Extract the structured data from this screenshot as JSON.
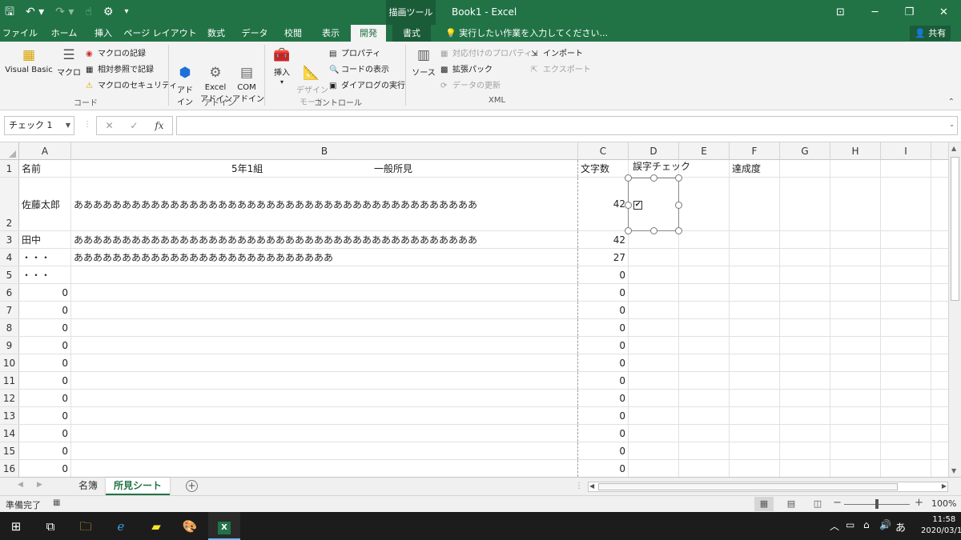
{
  "window": {
    "context_tab_title": "描画ツール",
    "doc_title": "Book1  -  Excel"
  },
  "tabs": [
    "ファイル",
    "ホーム",
    "挿入",
    "ページ レイアウト",
    "数式",
    "データ",
    "校閲",
    "表示",
    "開発",
    "書式"
  ],
  "active_tab": "開発",
  "tell_me": "実行したい作業を入力してください...",
  "share": "共有",
  "ribbon": {
    "code": {
      "visual_basic": "Visual Basic",
      "macro": "マクロ",
      "record_macro": "マクロの記録",
      "relative_ref": "相対参照で記録",
      "macro_security": "マクロのセキュリティ",
      "label": "コード"
    },
    "addins": {
      "addin": "アド\nイン",
      "excel_addin": "Excel\nアドイン",
      "com_addin": "COM\nアドイン",
      "label": "アドイン"
    },
    "controls": {
      "insert": "挿入",
      "design_mode": "デザイン\nモード",
      "properties": "プロパティ",
      "view_code": "コードの表示",
      "run_dialog": "ダイアログの実行",
      "label": "コントロール"
    },
    "xml": {
      "source": "ソース",
      "map_properties": "対応付けのプロパティ",
      "expansion_packs": "拡張パック",
      "refresh_data": "データの更新",
      "import": "インポート",
      "export": "エクスポート",
      "label": "XML"
    }
  },
  "formula_bar": {
    "name_box": "チェック 1",
    "fx": "fx",
    "value": ""
  },
  "columns": [
    "A",
    "B",
    "C",
    "D",
    "E",
    "F",
    "G",
    "H",
    "I"
  ],
  "rows": [
    {
      "n": "1",
      "a": "名前",
      "b_left": "5年1組",
      "b_right": "一般所見",
      "c": "文字数",
      "d": "",
      "f": "達成度"
    },
    {
      "n": "2",
      "a": "佐藤太郎",
      "b": "ああああああああああああああああああああああああああああああああああああああああああ",
      "c": "42"
    },
    {
      "n": "3",
      "a": "田中",
      "b": "ああああああああああああああああああああああああああああああああああああああああああ",
      "c": "42"
    },
    {
      "n": "4",
      "a": "・・・",
      "b": "あああああああああああああああああああああああああああ",
      "c": "27"
    },
    {
      "n": "5",
      "a": "・・・",
      "b": "",
      "c": "0"
    },
    {
      "n": "6",
      "a": "0",
      "b": "",
      "c": "0"
    },
    {
      "n": "7",
      "a": "0",
      "b": "",
      "c": "0"
    },
    {
      "n": "8",
      "a": "0",
      "b": "",
      "c": "0"
    },
    {
      "n": "9",
      "a": "0",
      "b": "",
      "c": "0"
    },
    {
      "n": "10",
      "a": "0",
      "b": "",
      "c": "0"
    },
    {
      "n": "11",
      "a": "0",
      "b": "",
      "c": "0"
    },
    {
      "n": "12",
      "a": "0",
      "b": "",
      "c": "0"
    },
    {
      "n": "13",
      "a": "0",
      "b": "",
      "c": "0"
    },
    {
      "n": "14",
      "a": "0",
      "b": "",
      "c": "0"
    },
    {
      "n": "15",
      "a": "0",
      "b": "",
      "c": "0"
    },
    {
      "n": "16",
      "a": "0",
      "b": "",
      "c": "0"
    }
  ],
  "checkbox": {
    "text": "誤字チェック",
    "checked": true
  },
  "sheets": [
    "名簿",
    "所見シート"
  ],
  "active_sheet": "所見シート",
  "status": {
    "text": "準備完了",
    "zoom": "100%"
  },
  "taskbar": {
    "ime": "あ",
    "time": "11:58",
    "date": "2020/03/18"
  },
  "colors": {
    "excel_green": "#217346"
  }
}
